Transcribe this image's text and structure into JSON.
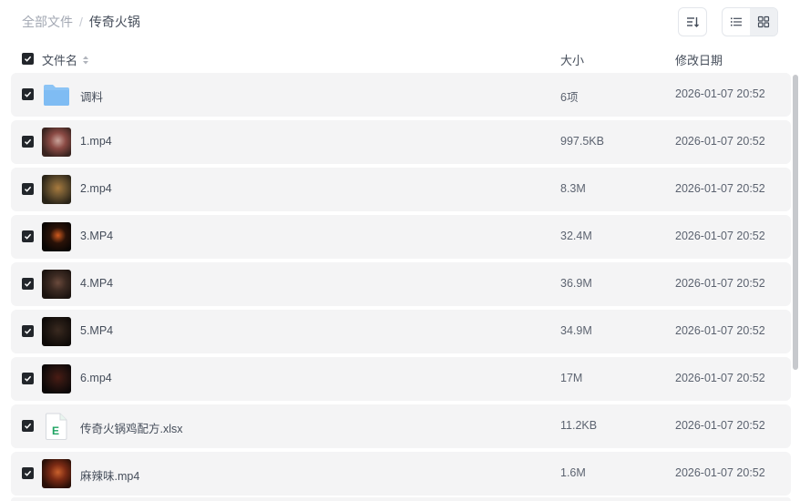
{
  "breadcrumb": {
    "root": "全部文件",
    "separator": "/",
    "current": "传奇火锅"
  },
  "columns": {
    "name": "文件名",
    "size": "大小",
    "date": "修改日期"
  },
  "files": [
    {
      "name": "调料",
      "size": "6项",
      "date": "2026-01-07 20:52",
      "kind": "folder",
      "thumb": "folder-icon"
    },
    {
      "name": "1.mp4",
      "size": "997.5KB",
      "date": "2026-01-07 20:52",
      "kind": "video",
      "thumb": "video-thumbnail"
    },
    {
      "name": "2.mp4",
      "size": "8.3M",
      "date": "2026-01-07 20:52",
      "kind": "video",
      "thumb": "video-thumbnail"
    },
    {
      "name": "3.MP4",
      "size": "32.4M",
      "date": "2026-01-07 20:52",
      "kind": "video",
      "thumb": "video-thumbnail"
    },
    {
      "name": "4.MP4",
      "size": "36.9M",
      "date": "2026-01-07 20:52",
      "kind": "video",
      "thumb": "video-thumbnail"
    },
    {
      "name": "5.MP4",
      "size": "34.9M",
      "date": "2026-01-07 20:52",
      "kind": "video",
      "thumb": "video-thumbnail"
    },
    {
      "name": "6.mp4",
      "size": "17M",
      "date": "2026-01-07 20:52",
      "kind": "video",
      "thumb": "video-thumbnail"
    },
    {
      "name": "传奇火锅鸡配方.xlsx",
      "size": "11.2KB",
      "date": "2026-01-07 20:52",
      "kind": "excel",
      "thumb": "excel-file-icon"
    },
    {
      "name": "麻辣味.mp4",
      "size": "1.6M",
      "date": "2026-01-07 20:52",
      "kind": "video",
      "thumb": "video-thumbnail"
    }
  ],
  "colors": {
    "accent_folder": "#7fbcf3",
    "excel_green": "#1fa463",
    "checkbox": "#22262b",
    "row_bg": "#f4f4f5"
  },
  "icons": {
    "sort": "sort-icon",
    "list_view": "list-view-icon",
    "grid_view": "grid-view-icon",
    "sort_arrows": "sort-arrows-icon"
  }
}
